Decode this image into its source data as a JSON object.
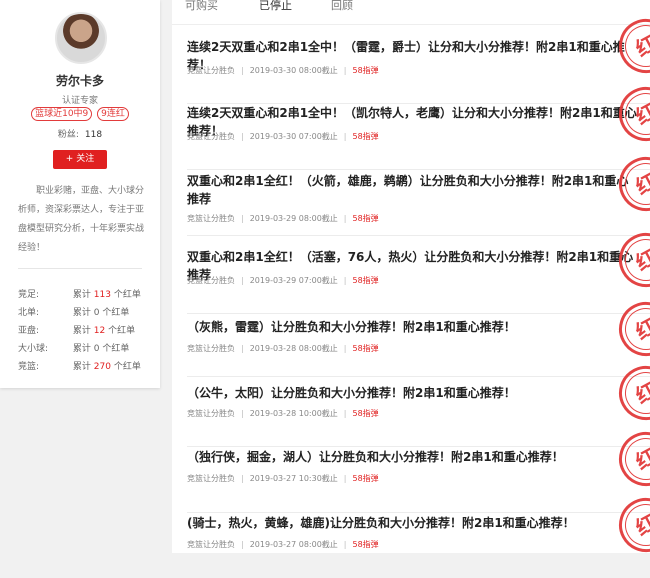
{
  "profile": {
    "name": "劳尔卡多",
    "role": "认证专家",
    "badges": [
      "篮球近10中9",
      "9连红"
    ],
    "fans_label": "粉丝:",
    "fans_count": "118",
    "follow_label": "+ 关注",
    "bio": "职业彩赌，亚盘、大小球分析师，资深彩票达人，专注于亚盘模型研究分析，十年彩票实战经验！",
    "stats": [
      {
        "key": "竞足:",
        "prefix": "累计",
        "num": "113",
        "suffix": "个红单"
      },
      {
        "key": "北单:",
        "prefix": "累计",
        "num": "0",
        "suffix": "个红单"
      },
      {
        "key": "亚盘:",
        "prefix": "累计",
        "num": "12",
        "suffix": "个红单"
      },
      {
        "key": "大小球:",
        "prefix": "累计",
        "num": "0",
        "suffix": "个红单"
      },
      {
        "key": "竞篮:",
        "prefix": "累计",
        "num": "270",
        "suffix": "个红单"
      }
    ]
  },
  "tabs": [
    "可购买",
    "已停止",
    "回顾"
  ],
  "items": [
    {
      "title": "连续2天双重心和2串1全中！（雷霆，爵士）让分和大小分推荐！附2串1和重心推荐！",
      "category": "竞篮让分胜负",
      "date": "2019-03-30 08:00截止",
      "price": "58指弹",
      "stamp": "红"
    },
    {
      "title": "连续2天双重心和2串1全中！（凯尔特人，老鹰）让分和大小分推荐！附2串1和重心推荐！",
      "category": "竞篮让分胜负",
      "date": "2019-03-30 07:00截止",
      "price": "58指弹",
      "stamp": "红"
    },
    {
      "title": "双重心和2串1全红！（火箭，雄鹿，鹈鹕）让分胜负和大小分推荐！附2串1和重心推荐",
      "category": "竞篮让分胜负",
      "date": "2019-03-29 08:00截止",
      "price": "58指弹",
      "stamp": "红"
    },
    {
      "title": "双重心和2串1全红！（活塞，76人，热火）让分胜负和大小分推荐！附2串1和重心推荐",
      "category": "竞篮让分胜负",
      "date": "2019-03-29 07:00截止",
      "price": "58指弹",
      "stamp": "红"
    },
    {
      "title": "（灰熊，雷霆）让分胜负和大小分推荐！附2串1和重心推荐！",
      "category": "竞篮让分胜负",
      "date": "2019-03-28 08:00截止",
      "price": "58指弹",
      "stamp": "红"
    },
    {
      "title": "（公牛，太阳）让分胜负和大小分推荐！附2串1和重心推荐！",
      "category": "竞篮让分胜负",
      "date": "2019-03-28 10:00截止",
      "price": "58指弹",
      "stamp": "红"
    },
    {
      "title": "（独行侠，掘金，湖人）让分胜负和大小分推荐！附2串1和重心推荐！",
      "category": "竞篮让分胜负",
      "date": "2019-03-27 10:30截止",
      "price": "58指弹",
      "stamp": "红"
    },
    {
      "title": "(骑士，热火，黄蜂，雄鹿)让分胜负和大小分推荐！附2串1和重心推荐！",
      "category": "竞篮让分胜负",
      "date": "2019-03-27 08:00截止",
      "price": "58指弹",
      "stamp": "红"
    }
  ]
}
